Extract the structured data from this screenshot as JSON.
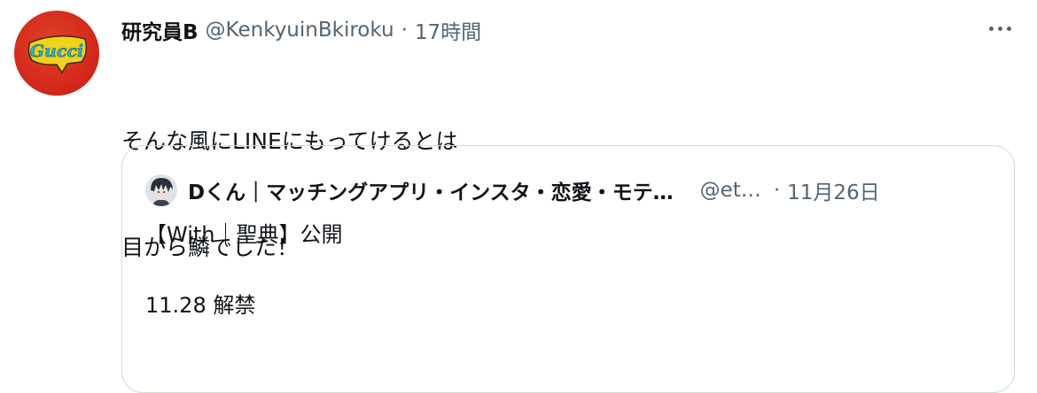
{
  "tweet": {
    "display_name": "研究員B",
    "handle": "@KenkyuinBkiroku",
    "separator": "·",
    "time": "17時間",
    "avatar_logo_text": "Gucci",
    "text_lines": [
      "そんな風にLINEにもってけるとは",
      "目から鱗でした！"
    ],
    "more_icon": "more-horizontal-icon"
  },
  "quote": {
    "display_name": "Dくん｜マッチングアプリ・インスタ・恋愛・モテ…",
    "handle": "@et…",
    "separator": "·",
    "time": "11月26日",
    "body_lines": [
      "【With｜聖典】公開",
      "",
      "11.28 解禁"
    ]
  },
  "colors": {
    "text_primary": "#0f1419",
    "text_secondary": "#536471",
    "border": "#cfd9de",
    "avatar_bg": "#d32a1c",
    "logo_fill": "#f2d21b",
    "logo_text": "#27b4c9"
  }
}
